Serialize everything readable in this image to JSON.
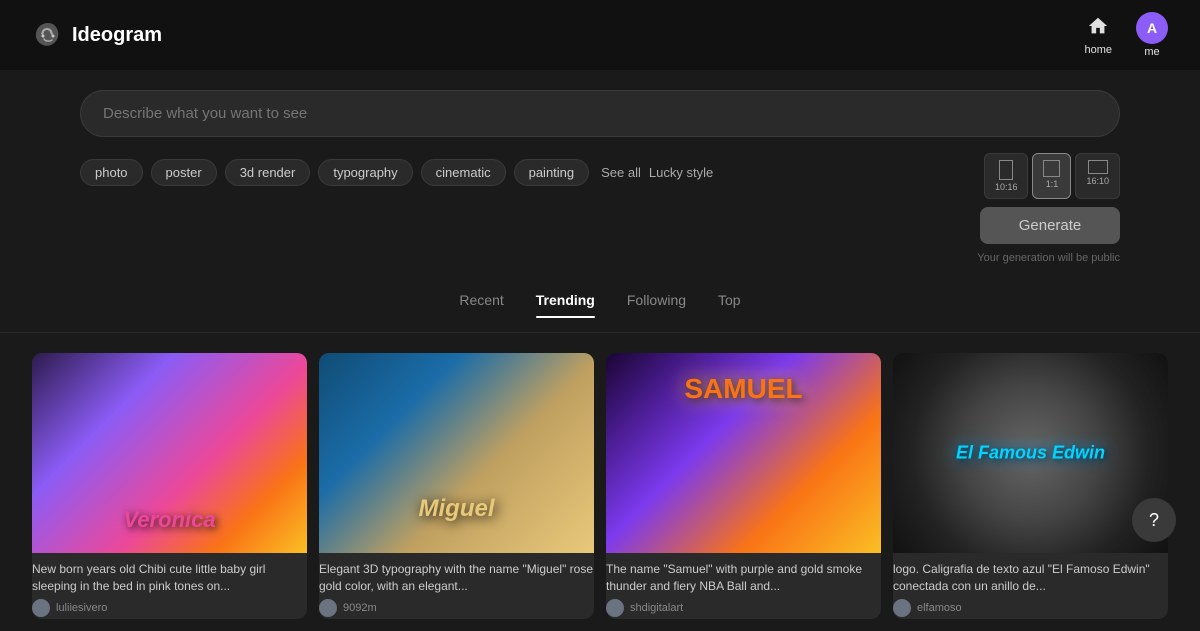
{
  "app": {
    "title": "Ideogram",
    "logo_icon": "brain-icon"
  },
  "nav": {
    "home_label": "home",
    "me_label": "me",
    "avatar_letter": "A"
  },
  "search": {
    "placeholder": "Describe what you want to see"
  },
  "filters": {
    "chips": [
      {
        "id": "photo",
        "label": "photo"
      },
      {
        "id": "poster",
        "label": "poster"
      },
      {
        "id": "3d-render",
        "label": "3d render"
      },
      {
        "id": "typography",
        "label": "typography"
      },
      {
        "id": "cinematic",
        "label": "cinematic"
      },
      {
        "id": "painting",
        "label": "painting"
      }
    ],
    "see_all_label": "See all",
    "lucky_style_label": "Lucky style"
  },
  "aspect_ratios": [
    {
      "id": "wide",
      "label": "10:16",
      "active": false
    },
    {
      "id": "square",
      "label": "1:1",
      "active": true
    },
    {
      "id": "landscape",
      "label": "16:10",
      "active": false
    }
  ],
  "toolbar": {
    "generate_label": "Generate",
    "public_notice": "Your generation will be public"
  },
  "tabs": [
    {
      "id": "recent",
      "label": "Recent",
      "active": false
    },
    {
      "id": "trending",
      "label": "Trending",
      "active": true
    },
    {
      "id": "following",
      "label": "Following",
      "active": false
    },
    {
      "id": "top",
      "label": "Top",
      "active": false
    }
  ],
  "cards": [
    {
      "id": "veronica",
      "description": "New born years old Chibi cute little baby girl sleeping in the bed in pink tones on...",
      "username": "luliiesivero",
      "avatar_color": "#6b7280"
    },
    {
      "id": "miguel",
      "description": "Elegant 3D typography with the name \"Miguel\" rose gold color, with an elegant...",
      "username": "9092m",
      "avatar_color": "#6b7280"
    },
    {
      "id": "samuel",
      "description": "The name \"Samuel\" with purple and gold smoke thunder and fiery NBA Ball and...",
      "username": "shdigitalart",
      "avatar_color": "#6b7280"
    },
    {
      "id": "edwin",
      "description": "logo. Caligrafia de texto azul \"El Famoso Edwin\" conectada con un anillo de...",
      "username": "elfamoso",
      "avatar_color": "#6b7280"
    }
  ],
  "help": {
    "label": "?"
  }
}
